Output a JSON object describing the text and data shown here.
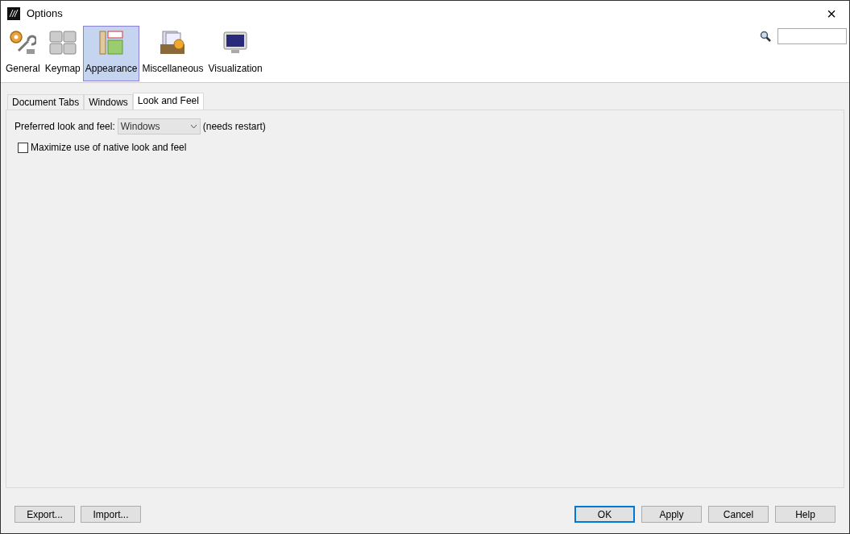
{
  "window": {
    "title": "Options",
    "close": "×"
  },
  "categories": [
    {
      "label": "General",
      "kind": "general",
      "selected": false
    },
    {
      "label": "Keymap",
      "kind": "keymap",
      "selected": false
    },
    {
      "label": "Appearance",
      "kind": "appearance",
      "selected": true
    },
    {
      "label": "Miscellaneous",
      "kind": "misc",
      "selected": false
    },
    {
      "label": "Visualization",
      "kind": "monitor",
      "selected": false
    }
  ],
  "tabs": [
    {
      "label": "Document Tabs",
      "selected": false
    },
    {
      "label": "Windows",
      "selected": false
    },
    {
      "label": "Look and Feel",
      "selected": true
    }
  ],
  "look_and_feel": {
    "label": "Preferred look and feel:",
    "value": "Windows",
    "note": "(needs restart)"
  },
  "options": [
    {
      "label": "Maximize use of native look and feel",
      "checked": false
    }
  ],
  "left_buttons": [
    {
      "label": "Export...",
      "default": false
    },
    {
      "label": "Import...",
      "default": false
    }
  ],
  "right_buttons": [
    {
      "label": "OK",
      "default": true
    },
    {
      "label": "Apply",
      "default": false
    },
    {
      "label": "Cancel",
      "default": false
    },
    {
      "label": "Help",
      "default": false
    }
  ]
}
